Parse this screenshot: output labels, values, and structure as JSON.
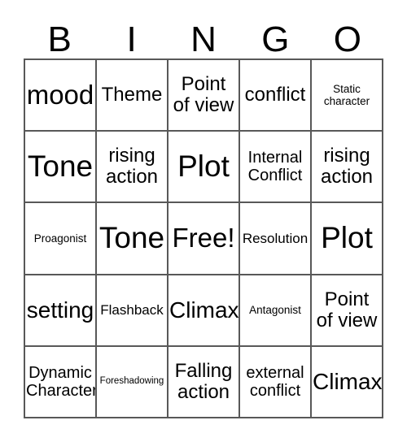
{
  "card": {
    "kind": "bingo-card",
    "background_color": "#ffffff",
    "text_color": "#000000",
    "border_color": "#585858",
    "columns": 5,
    "rows": 5
  },
  "header": {
    "letters": [
      "B",
      "I",
      "N",
      "G",
      "O"
    ]
  },
  "grid": {
    "cells": [
      {
        "text": "mood",
        "size": "s-xl",
        "free": false
      },
      {
        "text": "Theme",
        "size": "s-md",
        "free": false
      },
      {
        "text": "Point\nof view",
        "size": "s-md",
        "free": false
      },
      {
        "text": "conflict",
        "size": "s-md",
        "free": false
      },
      {
        "text": "Static\ncharacter",
        "size": "s-xxs",
        "free": false
      },
      {
        "text": "Tone",
        "size": "s-xxl",
        "free": false
      },
      {
        "text": "rising\naction",
        "size": "s-md",
        "free": false
      },
      {
        "text": "Plot",
        "size": "s-xxl",
        "free": false
      },
      {
        "text": "Internal\nConflict",
        "size": "s-sm",
        "free": false
      },
      {
        "text": "rising\naction",
        "size": "s-md",
        "free": false
      },
      {
        "text": "Proagonist",
        "size": "s-xxs",
        "free": false
      },
      {
        "text": "Tone",
        "size": "s-xxl",
        "free": false
      },
      {
        "text": "Free!",
        "size": "s-xl",
        "free": true
      },
      {
        "text": "Resolution",
        "size": "s-xs",
        "free": false
      },
      {
        "text": "Plot",
        "size": "s-xxl",
        "free": false
      },
      {
        "text": "setting",
        "size": "s-lg",
        "free": false
      },
      {
        "text": "Flashback",
        "size": "s-xs",
        "free": false
      },
      {
        "text": "Climax",
        "size": "s-lg",
        "free": false
      },
      {
        "text": "Antagonist",
        "size": "s-xxs",
        "free": false
      },
      {
        "text": "Point\nof view",
        "size": "s-md",
        "free": false
      },
      {
        "text": "Dynamic\nCharacter",
        "size": "s-sm",
        "free": false
      },
      {
        "text": "Foreshadowing",
        "size": "s-tiny",
        "free": false
      },
      {
        "text": "Falling\naction",
        "size": "s-md",
        "free": false
      },
      {
        "text": "external\nconflict",
        "size": "s-sm",
        "free": false
      },
      {
        "text": "Climax",
        "size": "s-lg",
        "free": false
      }
    ]
  }
}
